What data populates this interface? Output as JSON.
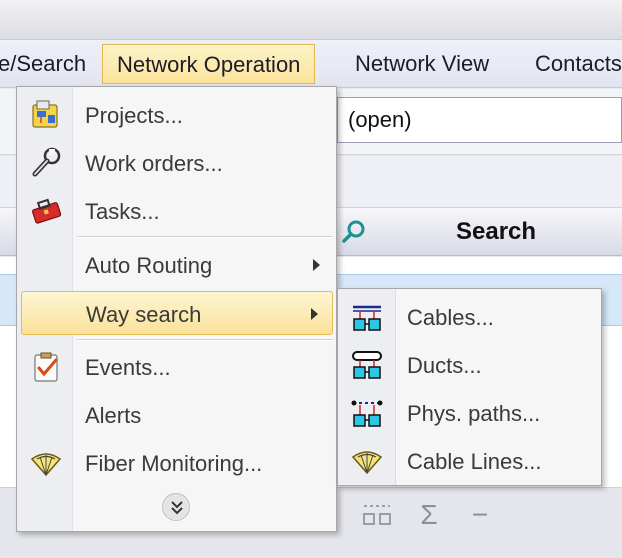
{
  "menubar": {
    "items": [
      {
        "label": "e/Search",
        "active": false
      },
      {
        "label": "Network Operation",
        "active": true
      },
      {
        "label": "Network View",
        "active": false
      },
      {
        "label": "Contacts",
        "active": false
      }
    ]
  },
  "toolbar": {
    "combo_value": "(open)"
  },
  "grid": {
    "search_header": "Search"
  },
  "menu": {
    "items": [
      {
        "label": "Projects...",
        "icon": "projects-icon",
        "submenu": false
      },
      {
        "label": "Work orders...",
        "icon": "wrench-icon",
        "submenu": false
      },
      {
        "label": "Tasks...",
        "icon": "toolbox-icon",
        "submenu": false
      },
      {
        "label": "Auto Routing",
        "icon": "",
        "submenu": true
      },
      {
        "label": "Way search",
        "icon": "",
        "submenu": true,
        "highlighted": true
      },
      {
        "label": "Events...",
        "icon": "clipboard-check-icon",
        "submenu": false
      },
      {
        "label": "Alerts",
        "icon": "",
        "submenu": false
      },
      {
        "label": "Fiber Monitoring...",
        "icon": "fiber-fan-icon",
        "submenu": false
      }
    ]
  },
  "submenu": {
    "items": [
      {
        "label": "Cables...",
        "icon": "cable-icon"
      },
      {
        "label": "Ducts...",
        "icon": "duct-icon"
      },
      {
        "label": "Phys. paths...",
        "icon": "phys-path-icon"
      },
      {
        "label": "Cable Lines...",
        "icon": "fiber-fan-icon"
      }
    ]
  },
  "colors": {
    "highlight_top": "#fdf5d2",
    "highlight_bottom": "#fbe29a",
    "highlight_border": "#e3bd53",
    "menu_bg": "#f6f6f6",
    "gutter_bg": "#eceef2"
  }
}
